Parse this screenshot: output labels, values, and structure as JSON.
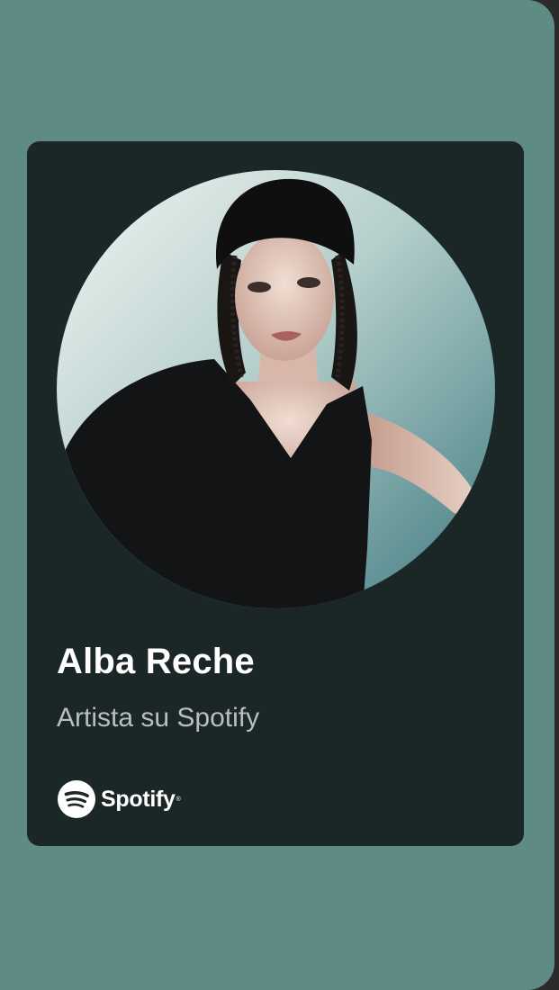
{
  "card": {
    "artist_name": "Alba Reche",
    "subtitle": "Artista su Spotify",
    "brand_wordmark": "Spotify",
    "registered_mark": "®"
  },
  "icons": {
    "brand_logo": "spotify-logo-icon"
  },
  "colors": {
    "background": "#5f8b85",
    "card_background": "#1b2726",
    "title_text": "#ffffff",
    "subtitle_text": "#b9bfbd"
  }
}
